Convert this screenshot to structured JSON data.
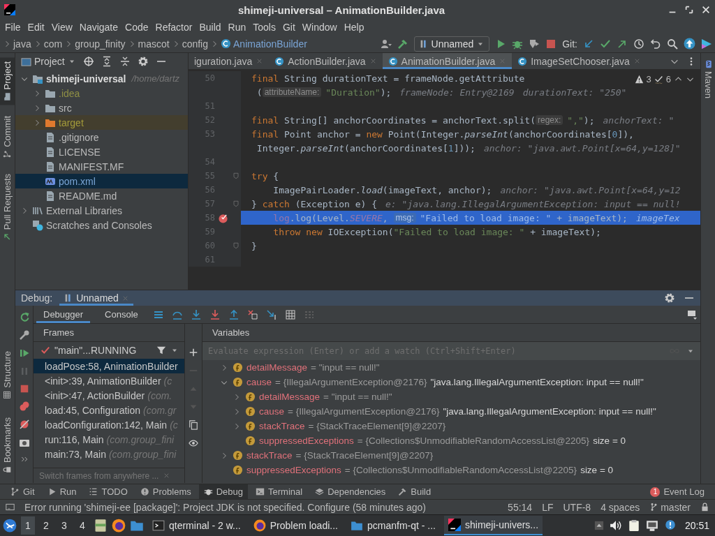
{
  "window": {
    "title": "shimeji-universal – AnimationBuilder.java"
  },
  "menu": [
    "File",
    "Edit",
    "View",
    "Navigate",
    "Code",
    "Refactor",
    "Build",
    "Run",
    "Tools",
    "Git",
    "Window",
    "Help"
  ],
  "breadcrumbs": [
    {
      "label": "java",
      "kind": "package"
    },
    {
      "label": "com",
      "kind": "package"
    },
    {
      "label": "group_finity",
      "kind": "package"
    },
    {
      "label": "mascot",
      "kind": "package"
    },
    {
      "label": "config",
      "kind": "package"
    },
    {
      "label": "AnimationBuilder",
      "kind": "class"
    }
  ],
  "toolbar": {
    "run_config": "Unnamed",
    "git_label": "Git:"
  },
  "side_tabs_top": [
    {
      "label": "Project",
      "selected": true
    },
    {
      "label": "Commit",
      "selected": false
    },
    {
      "label": "Pull Requests",
      "selected": false
    }
  ],
  "side_tabs_bottom": [
    {
      "label": "Structure",
      "selected": false
    },
    {
      "label": "Bookmarks",
      "selected": false
    }
  ],
  "side_tabs_right": [
    {
      "label": "Maven",
      "selected": false
    }
  ],
  "project": {
    "title": "Project",
    "tree": [
      {
        "label": "shimeji-universal",
        "path": "/home/dartz",
        "kind": "module",
        "color": "#dddddd",
        "expanded": true,
        "selected": false,
        "children": [
          {
            "label": ".idea",
            "kind": "folder",
            "color": "#8f8f45",
            "expanded": false,
            "selected": false
          },
          {
            "label": "src",
            "kind": "folder",
            "color": "#bbbbbb",
            "expanded": false,
            "selected": false
          },
          {
            "label": "target",
            "kind": "excluded-folder",
            "color": "#a49b3a",
            "expanded": false,
            "selected": false
          },
          {
            "label": ".gitignore",
            "kind": "file",
            "color": "#bbbbbb",
            "selected": false
          },
          {
            "label": "LICENSE",
            "kind": "file",
            "color": "#bbbbbb",
            "selected": false
          },
          {
            "label": "MANIFEST.MF",
            "kind": "file",
            "color": "#bbbbbb",
            "selected": false
          },
          {
            "label": "pom.xml",
            "kind": "maven",
            "color": "#7aa5d6",
            "selected": true
          },
          {
            "label": "README.md",
            "kind": "file",
            "color": "#bbbbbb",
            "selected": false
          }
        ]
      },
      {
        "label": "External Libraries",
        "kind": "libraries",
        "color": "#bbbbbb",
        "expanded": false,
        "selected": false
      },
      {
        "label": "Scratches and Consoles",
        "kind": "scratches",
        "color": "#bbbbbb",
        "selected": false
      }
    ]
  },
  "editor": {
    "tabs": [
      {
        "label": "iguration.java",
        "selected": false
      },
      {
        "label": "ActionBuilder.java",
        "selected": false
      },
      {
        "label": "AnimationBuilder.java",
        "selected": true
      },
      {
        "label": "ImageSetChooser.java",
        "selected": false
      }
    ],
    "warnings": "3",
    "weak_warnings": "6",
    "lines": [
      {
        "number": "50",
        "fold": false,
        "breakpoint": false,
        "current": false,
        "segments": [
          {
            "kind": "kw",
            "text": "final "
          },
          {
            "kind": "plain",
            "text": "String durationText = frameNode.getAttribute"
          }
        ]
      },
      {
        "fold": false,
        "breakpoint": false,
        "current": false,
        "segments": [
          {
            "kind": "plain",
            "text": " ("
          },
          {
            "kind": "param",
            "text": "attributeName:"
          },
          {
            "kind": "str",
            "text": "\"Duration\""
          },
          {
            "kind": "plain",
            "text": ");"
          },
          {
            "kind": "hint",
            "text": "frameNode: Entry@2169"
          },
          {
            "kind": "hint",
            "text": "durationText: \"250\""
          }
        ]
      },
      {
        "number": "51",
        "fold": false,
        "breakpoint": false,
        "current": false
      },
      {
        "number": "52",
        "fold": false,
        "breakpoint": false,
        "current": false,
        "segments": [
          {
            "kind": "kw",
            "text": "final "
          },
          {
            "kind": "plain",
            "text": "String[] anchorCoordinates = anchorText.split("
          },
          {
            "kind": "param",
            "text": "regex:"
          },
          {
            "kind": "str",
            "text": "\",\""
          },
          {
            "kind": "plain",
            "text": ");"
          },
          {
            "kind": "hint",
            "text": "anchorText: \""
          }
        ]
      },
      {
        "number": "53",
        "fold": false,
        "breakpoint": false,
        "current": false,
        "segments": [
          {
            "kind": "kw",
            "text": "final "
          },
          {
            "kind": "plain",
            "text": "Point anchor = "
          },
          {
            "kind": "kw",
            "text": "new "
          },
          {
            "kind": "plain",
            "text": "Point(Integer."
          },
          {
            "kind": "static",
            "text": "parseInt"
          },
          {
            "kind": "plain",
            "text": "(anchorCoordinates["
          },
          {
            "kind": "num",
            "text": "0"
          },
          {
            "kind": "plain",
            "text": "]),"
          }
        ]
      },
      {
        "fold": false,
        "breakpoint": false,
        "current": false,
        "segments": [
          {
            "kind": "plain",
            "text": " Integer."
          },
          {
            "kind": "static",
            "text": "parseInt"
          },
          {
            "kind": "plain",
            "text": "(anchorCoordinates["
          },
          {
            "kind": "num",
            "text": "1"
          },
          {
            "kind": "plain",
            "text": "]));"
          },
          {
            "kind": "hint",
            "text": "anchor: \"java.awt.Point[x=64,y=128]\""
          }
        ]
      },
      {
        "number": "54",
        "fold": false,
        "breakpoint": false,
        "current": false
      },
      {
        "number": "55",
        "fold": true,
        "breakpoint": false,
        "current": false,
        "segments": [
          {
            "kind": "kw",
            "text": "try "
          },
          {
            "kind": "plain",
            "text": "{"
          }
        ]
      },
      {
        "number": "56",
        "fold": false,
        "breakpoint": false,
        "current": false,
        "segments": [
          {
            "kind": "plain",
            "text": "    ImagePairLoader."
          },
          {
            "kind": "static",
            "text": "load"
          },
          {
            "kind": "plain",
            "text": "(imageText, anchor);"
          },
          {
            "kind": "hint",
            "text": "anchor: \"java.awt.Point[x=64,y=12"
          }
        ]
      },
      {
        "number": "57",
        "fold": true,
        "breakpoint": false,
        "current": false,
        "segments": [
          {
            "kind": "plain",
            "text": "} "
          },
          {
            "kind": "kw",
            "text": "catch "
          },
          {
            "kind": "plain",
            "text": "(Exception e) {"
          },
          {
            "kind": "hint",
            "text": "e: \"java.lang.IllegalArgumentException: input == null!"
          }
        ]
      },
      {
        "number": "58",
        "fold": false,
        "breakpoint": true,
        "current": true,
        "segments": [
          {
            "kind": "field",
            "text": "    log"
          },
          {
            "kind": "plain",
            "text": ".log(Level."
          },
          {
            "kind": "const",
            "text": "SEVERE"
          },
          {
            "kind": "plain",
            "text": ", "
          },
          {
            "kind": "param",
            "text": "msg:"
          },
          {
            "kind": "str",
            "text": "\"Failed to load image: \""
          },
          {
            "kind": "plain",
            "text": " + imageText);"
          },
          {
            "kind": "hint",
            "text": "imageTex"
          }
        ]
      },
      {
        "number": "59",
        "fold": false,
        "breakpoint": false,
        "current": false,
        "segments": [
          {
            "kind": "kw",
            "text": "    throw new "
          },
          {
            "kind": "plain",
            "text": "IOException("
          },
          {
            "kind": "str",
            "text": "\"Failed to load image: \""
          },
          {
            "kind": "plain",
            "text": " + imageText);"
          }
        ]
      },
      {
        "number": "60",
        "fold": true,
        "breakpoint": false,
        "current": false,
        "segments": [
          {
            "kind": "plain",
            "text": "}"
          }
        ]
      },
      {
        "number": "61",
        "fold": false,
        "breakpoint": false,
        "current": false
      }
    ]
  },
  "debug": {
    "label": "Debug:",
    "tabs": [
      {
        "label": "Unnamed",
        "selected": true
      }
    ],
    "subtabs": [
      {
        "label": "Debugger",
        "selected": true
      },
      {
        "label": "Console",
        "selected": false
      }
    ],
    "frames": {
      "title": "Frames",
      "thread": "\"main\"...RUNNING",
      "items": [
        {
          "method": "loadPose:58, AnimationBuilder",
          "selected": true
        },
        {
          "method": "<init>:39, AnimationBuilder",
          "location": "(c",
          "selected": false
        },
        {
          "method": "<init>:47, ActionBuilder",
          "location": "(com.",
          "selected": false
        },
        {
          "method": "load:45, Configuration",
          "location": "(com.gr",
          "selected": false
        },
        {
          "method": "loadConfiguration:142, Main",
          "location": "(c",
          "selected": false
        },
        {
          "method": "run:116, Main",
          "location": "(com.group_fini",
          "selected": false
        },
        {
          "method": "main:73, Main",
          "location": "(com.group_fini",
          "selected": false
        }
      ],
      "hint": "Switch frames from anywhere ..."
    },
    "variables": {
      "title": "Variables",
      "placeholder": "Evaluate expression (Enter) or add a watch (Ctrl+Shift+Enter)",
      "items": [
        {
          "name": "detailMessage",
          "type": "= \"input == null!\"",
          "expanded": false
        },
        {
          "name": "cause",
          "type": "= {IllegalArgumentException@2176}",
          "value": "\"java.lang.IllegalArgumentException: input == null!\"",
          "expanded": true,
          "children": [
            {
              "name": "detailMessage",
              "type": "= \"input == null!\"",
              "expanded": false
            },
            {
              "name": "cause",
              "type": "= {IllegalArgumentException@2176}",
              "value": "\"java.lang.IllegalArgumentException: input == null!\"",
              "expanded": false
            },
            {
              "name": "stackTrace",
              "type": "= {StackTraceElement[9]@2207}",
              "expanded": false
            },
            {
              "name": "suppressedExceptions",
              "type": "= {Collections$UnmodifiableRandomAccessList@2205}",
              "value": "size = 0"
            }
          ]
        },
        {
          "name": "stackTrace",
          "type": "= {StackTraceElement[9]@2207}",
          "expanded": false
        },
        {
          "name": "suppressedExceptions",
          "type": "= {Collections$UnmodifiableRandomAccessList@2205}",
          "value": "size = 0"
        }
      ]
    }
  },
  "tool_bar": {
    "items": [
      {
        "label": "Git",
        "kind": "git",
        "selected": false
      },
      {
        "label": "Run",
        "kind": "run",
        "selected": false
      },
      {
        "label": "TODO",
        "kind": "todo",
        "selected": false
      },
      {
        "label": "Problems",
        "kind": "problems",
        "selected": false
      },
      {
        "label": "Debug",
        "kind": "debug",
        "selected": true
      },
      {
        "label": "Terminal",
        "kind": "terminal",
        "selected": false
      },
      {
        "label": "Dependencies",
        "kind": "dependencies",
        "selected": false
      },
      {
        "label": "Build",
        "kind": "build",
        "selected": false
      }
    ],
    "event_log": {
      "label": "Event Log",
      "badge": "1"
    }
  },
  "status_bar": {
    "message": "Error running 'shimeji-ee [package]': Project JDK is not specified. Configure (58 minutes ago)",
    "items": [
      "55:14",
      "LF",
      "UTF-8",
      "4 spaces"
    ],
    "branch": "master"
  },
  "taskbar": {
    "desktops": [
      {
        "label": "1",
        "selected": true
      },
      {
        "label": "2",
        "selected": false
      },
      {
        "label": "3",
        "selected": false
      },
      {
        "label": "4",
        "selected": false
      }
    ],
    "windows": [
      {
        "label": "qterminal - 2 w...",
        "kind": "terminal",
        "selected": false
      },
      {
        "label": "Problem loadi...",
        "kind": "browser",
        "selected": false
      },
      {
        "label": "pcmanfm-qt - ...",
        "kind": "folder",
        "selected": false
      },
      {
        "label": "shimeji-univers...",
        "kind": "ide",
        "selected": true
      }
    ],
    "clock": "20:51"
  }
}
